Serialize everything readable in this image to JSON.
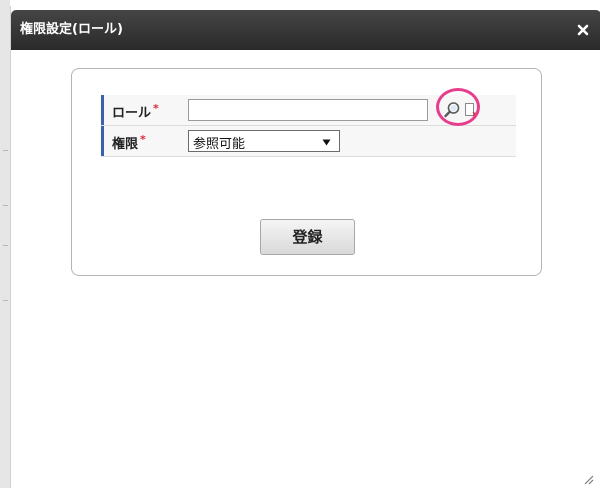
{
  "dialog": {
    "title": "権限設定(ロール)",
    "close_icon": "close-icon"
  },
  "form": {
    "role": {
      "label": "ロール",
      "required_mark": "*",
      "value": "",
      "search_icon": "search-icon",
      "clear_icon": "clear-icon"
    },
    "permission": {
      "label": "権限",
      "required_mark": "*",
      "selected": "参照可能"
    },
    "submit_label": "登録"
  },
  "colors": {
    "titlebar": "#333333",
    "label_accent": "#3a62a8",
    "required": "#e0283c",
    "highlight": "#e83c8c"
  }
}
